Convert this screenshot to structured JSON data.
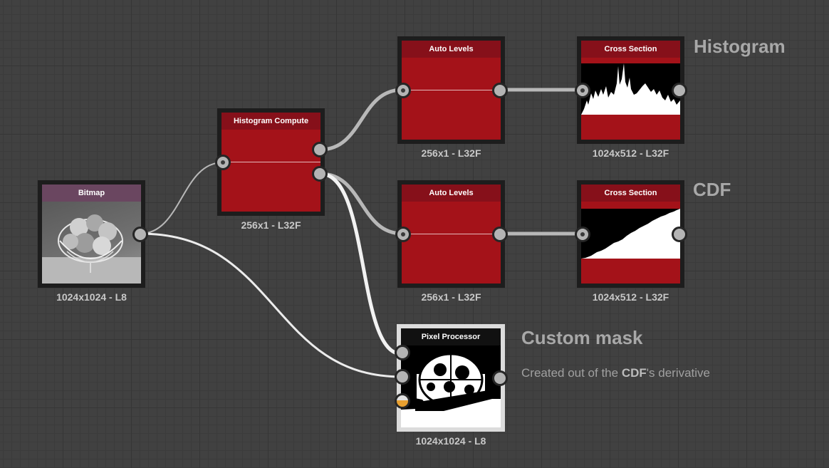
{
  "nodes": {
    "bitmap": {
      "title": "Bitmap",
      "info": "1024x1024 - L8"
    },
    "histogram_compute": {
      "title": "Histogram Compute",
      "info": "256x1 - L32F"
    },
    "auto_levels_top": {
      "title": "Auto Levels",
      "info": "256x1 - L32F"
    },
    "auto_levels_bottom": {
      "title": "Auto Levels",
      "info": "256x1 - L32F"
    },
    "cross_section_top": {
      "title": "Cross Section",
      "info": "1024x512 - L32F"
    },
    "cross_section_bottom": {
      "title": "Cross Section",
      "info": "1024x512 - L32F"
    },
    "pixel_processor": {
      "title": "Pixel Processor",
      "info": "1024x1024 - L8"
    }
  },
  "comments": {
    "histogram": "Histogram",
    "cdf": "CDF",
    "custom_mask": "Custom mask",
    "custom_mask_desc_pre": "Created out of the ",
    "custom_mask_desc_bold": "CDF",
    "custom_mask_desc_post": "'s derivative"
  },
  "colors": {
    "canvas": "#414141",
    "node_red": "#a41219",
    "node_red_header": "#86101a",
    "bitmap_header": "#6a4660",
    "wire_white": "#e6e6e6",
    "wire_grey": "#aaaaaa"
  },
  "icons": {
    "port": "circle",
    "mask_port": "half-filled-circle"
  }
}
